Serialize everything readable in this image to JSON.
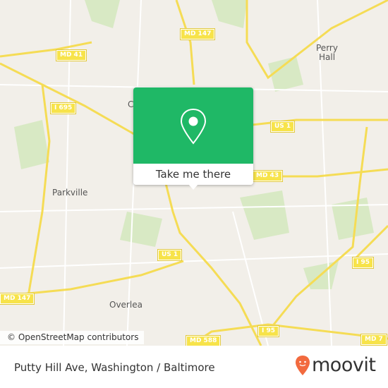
{
  "map": {
    "shields": [
      {
        "label": "MD 147"
      },
      {
        "label": "MD 41"
      },
      {
        "label": "I 695"
      },
      {
        "label": "US 1"
      },
      {
        "label": "MD 43"
      },
      {
        "label": "US 1"
      },
      {
        "label": "I 95"
      },
      {
        "label": "MD 147"
      },
      {
        "label": "I 95"
      },
      {
        "label": "MD 588"
      },
      {
        "label": "MD 7"
      }
    ],
    "places": [
      {
        "label": "Perry"
      },
      {
        "label": "Hall"
      },
      {
        "label": "Parkville"
      },
      {
        "label": "Overlea"
      },
      {
        "label": "C"
      }
    ],
    "attribution": "© OpenStreetMap contributors"
  },
  "popup": {
    "icon": "map-pin-icon",
    "button_label": "Take me there",
    "color": "#1fb866"
  },
  "footer": {
    "title": "Putty Hill Ave, Washington / Baltimore",
    "brand": "moovit",
    "brand_color": "#f26a3e"
  }
}
